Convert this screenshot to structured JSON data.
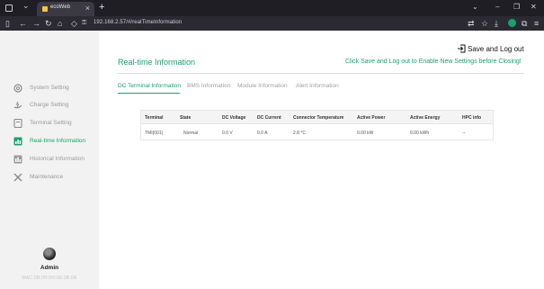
{
  "browser": {
    "tab_title": "ecoWeb",
    "tab_close": "×",
    "new_tab": "+",
    "url": "192.168.2.57/#/realTimeInformation",
    "icons": [
      "window-icon",
      "tabs-chevron-icon",
      "back-icon",
      "forward-icon",
      "reload-icon",
      "home-icon",
      "shield-icon",
      "lock-icon",
      "translate-icon",
      "bookmark-icon",
      "download-icon",
      "extension-icon",
      "menu-icon"
    ]
  },
  "app": {
    "accent_color": "#1aa06d",
    "logout_label": "Save and Log out",
    "page_title": "Real-time Information",
    "notice": "Click Save and Log out to Enable New Settings before Closing!",
    "sidebar": {
      "items": [
        {
          "label": "System Setting",
          "icon": "gear-icon",
          "active": false
        },
        {
          "label": "Charge Setting",
          "icon": "hand-charge-icon",
          "active": false
        },
        {
          "label": "Terminal Setting",
          "icon": "terminal-icon",
          "active": false
        },
        {
          "label": "Real-time Information",
          "icon": "realtime-icon",
          "active": true
        },
        {
          "label": "Historical Information",
          "icon": "history-icon",
          "active": false
        },
        {
          "label": "Maintenance",
          "icon": "tools-icon",
          "active": false
        }
      ],
      "user": "Admin",
      "mac": "MAC:0B:0H:0H:0E:0B:0A"
    },
    "tabs": [
      {
        "label": "DC Terminal Information",
        "active": true
      },
      {
        "label": "BMS Information",
        "active": false
      },
      {
        "label": "Module Information",
        "active": false
      },
      {
        "label": "Alert Information",
        "active": false
      }
    ],
    "table": {
      "headers": [
        "Terminal",
        "State",
        "DC Voltage",
        "DC Current",
        "Connector Temperature",
        "Active Power",
        "Active Energy",
        "HPC info"
      ],
      "rows": [
        [
          "TMI(001)",
          "Normal",
          "0.0 V",
          "0.0 A",
          "2.8 °C",
          "0.00 kW",
          "0.00 kWh",
          "--"
        ]
      ]
    }
  }
}
